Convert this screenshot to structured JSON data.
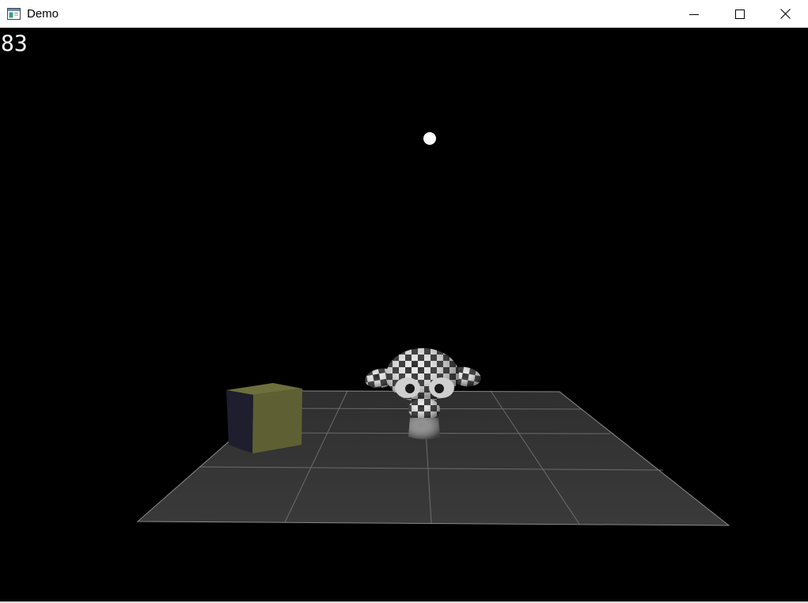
{
  "window": {
    "title": "Demo",
    "icon": "app-window-icon",
    "controls": [
      "minimize-icon",
      "maximize-icon",
      "close-icon"
    ]
  },
  "viewport": {
    "fps_counter": "83",
    "background_color": "#000000",
    "scene_objects": [
      "light-source",
      "tiled-floor",
      "textured-cube",
      "checkered-monkey-head"
    ]
  }
}
